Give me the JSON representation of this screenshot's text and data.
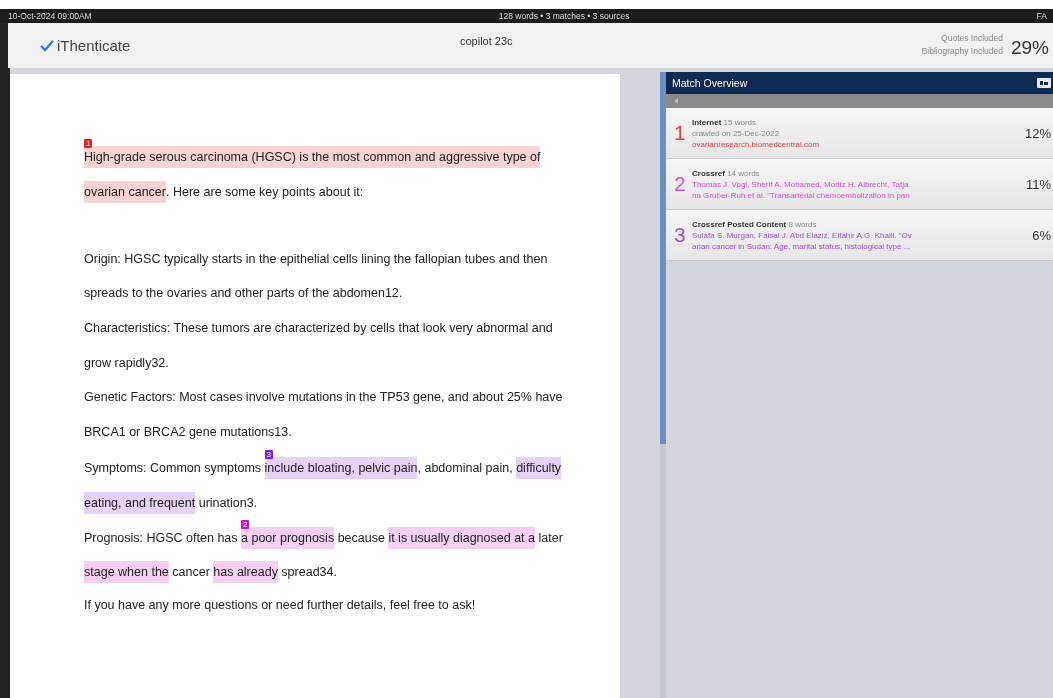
{
  "status_strip": {
    "date": "10-Oct-2024 09:00AM",
    "summary": "128 words • 3 matches • 3 sources",
    "corner": "FA"
  },
  "header": {
    "logo": "iThenticate",
    "document_title": "copilot 23c",
    "quotes": "Quotes Included",
    "bibliography": "Bibliography Included",
    "similarity": "29%"
  },
  "document": {
    "lines": [
      {
        "segments": [
          {
            "text": "High-grade serous carcinoma (HGSC) is the most common and aggressive type of",
            "color": "#f9d3d3",
            "marker": "1"
          }
        ]
      },
      {
        "segments": [
          {
            "text": "ovarian cancer",
            "color": "#f9d3d3"
          },
          {
            "text": ". Here are some key points about it:"
          }
        ]
      },
      {
        "blank_line_before": true,
        "segments": [
          {
            "text": "Origin: HGSC typically starts in the epithelial cells lining the fallopian tubes and then"
          }
        ]
      },
      {
        "segments": [
          {
            "text": "spreads to the ovaries and other parts of the abdomen12."
          }
        ]
      },
      {
        "segments": [
          {
            "text": "Characteristics: These tumors are characterized by cells that look very abnormal and"
          }
        ]
      },
      {
        "segments": [
          {
            "text": "grow rapidly32."
          }
        ]
      },
      {
        "segments": [
          {
            "text": "Genetic Factors: Most cases involve mutations in the TP53 gene, and about 25% have"
          }
        ]
      },
      {
        "segments": [
          {
            "text": "BRCA1 or BRCA2 gene mutations13."
          }
        ]
      },
      {
        "segments": [
          {
            "text": "Symptoms: Common symptoms "
          },
          {
            "text": "include bloating, pelvic pain",
            "color": "#e5d2fa",
            "marker": "3"
          },
          {
            "text": ", abdominal pain, "
          },
          {
            "text": "difficulty",
            "color": "#e5d2fa"
          }
        ]
      },
      {
        "segments": [
          {
            "text": "eating, and frequent",
            "color": "#e5d2fa"
          },
          {
            "text": " urination3."
          }
        ]
      },
      {
        "segments": [
          {
            "text": "Prognosis: HGSC often has "
          },
          {
            "text": "a poor prognosis",
            "color": "#f7cff3",
            "marker": "2"
          },
          {
            "text": " because "
          },
          {
            "text": "it is usually diagnosed at a",
            "color": "#f7cff3"
          },
          {
            "text": " later"
          }
        ]
      },
      {
        "segments": [
          {
            "text": "stage when the",
            "color": "#f7cff3"
          },
          {
            "text": " cancer "
          },
          {
            "text": "has already",
            "color": "#f7cff3"
          },
          {
            "text": " spread34."
          }
        ]
      },
      {
        "segments": [
          {
            "text": "If you have any more questions or need further details, feel free to ask!"
          }
        ]
      }
    ]
  },
  "match_overview": {
    "title": "Match Overview",
    "sources": [
      {
        "number": "1",
        "color": "#e8414a",
        "type": "Internet",
        "words": "15 words",
        "line_1": "crawled on 25-Dec-2022",
        "line_2": "ovarianresearch.biomedcentral.com",
        "percent": "12%",
        "muted_line_1": true
      },
      {
        "number": "2",
        "color": "#d94fd0",
        "type": "Crossref",
        "words": "14 words",
        "line_1": "Thomas J. Vogl, Sherif A. Mohamed, Moritz H. Albrecht, Tatja",
        "line_2": "na Gruber-Ruh et al. \"Transarterial chemoembolization in pan",
        "percent": "11%",
        "muted_line_1": false
      },
      {
        "number": "3",
        "color": "#9b4fe0",
        "type": "Crossref Posted Content",
        "words": "8 words",
        "line_1": "Sulafa S. Murgan, Faisal J. Abd Elaziz, Eltahir A.G. Khalil. \"Ov",
        "line_2": "arian cancer in Sudan: Age, marital status, histological type ...",
        "percent": "6%",
        "muted_line_1": false
      }
    ]
  }
}
